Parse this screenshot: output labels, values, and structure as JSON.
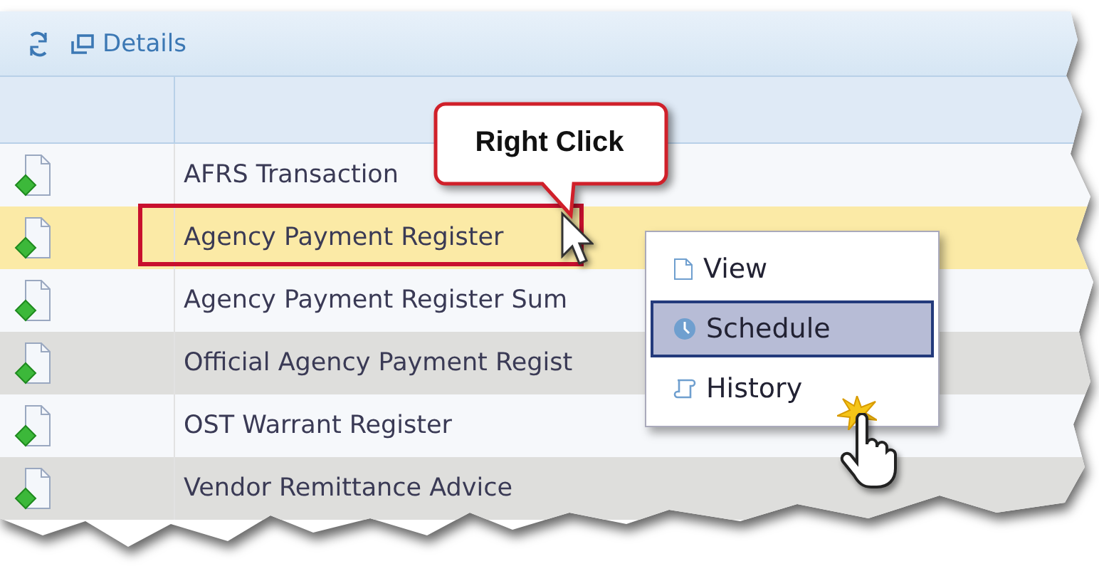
{
  "toolbar": {
    "details_label": "Details"
  },
  "table": {
    "rows": [
      {
        "name": "AFRS Transaction",
        "selected": false
      },
      {
        "name": "Agency Payment Register",
        "selected": true
      },
      {
        "name": "Agency Payment Register Sum",
        "selected": false
      },
      {
        "name": "Official Agency Payment Regist",
        "selected": false
      },
      {
        "name": "OST Warrant Register",
        "selected": false
      },
      {
        "name": "Vendor Remittance Advice",
        "selected": false
      }
    ]
  },
  "callout": {
    "text": "Right Click"
  },
  "context_menu": {
    "items": [
      {
        "label": "View",
        "selected": false
      },
      {
        "label": "Schedule",
        "selected": true
      },
      {
        "label": "History",
        "selected": false
      }
    ]
  }
}
